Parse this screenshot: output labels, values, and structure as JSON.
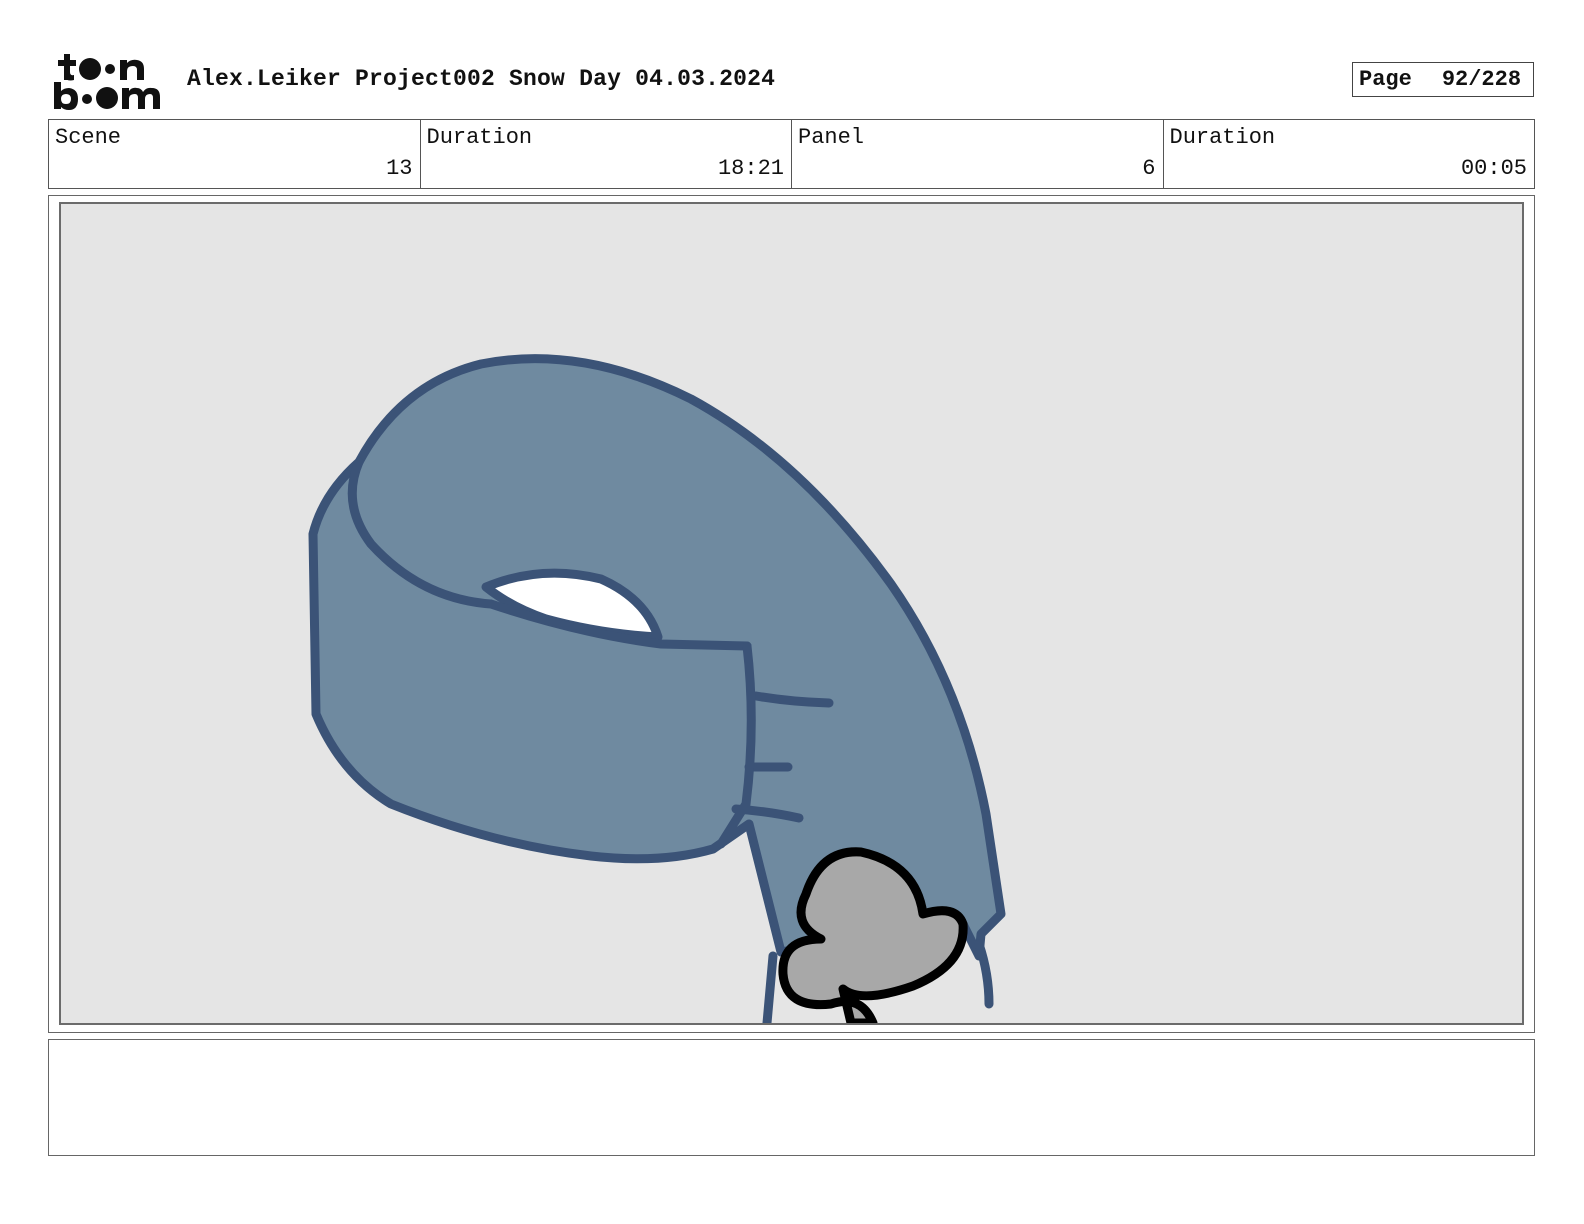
{
  "header": {
    "logo_text": "toon boom",
    "title": "Alex.Leiker Project002 Snow Day 04.03.2024",
    "page_label": "Page",
    "page_value": "92/228"
  },
  "info": {
    "scene_label": "Scene",
    "scene_value": "13",
    "scene_duration_label": "Duration",
    "scene_duration_value": "18:21",
    "panel_label": "Panel",
    "panel_value": "6",
    "panel_duration_label": "Duration",
    "panel_duration_value": "00:05"
  },
  "panel": {
    "background_color": "#e5e5e5",
    "scarf_fill": "#6f8aa0",
    "scarf_outline": "#3b5377",
    "hand_fill": "#a8a8a8",
    "hand_outline": "#000000"
  },
  "notes": {
    "text": ""
  }
}
